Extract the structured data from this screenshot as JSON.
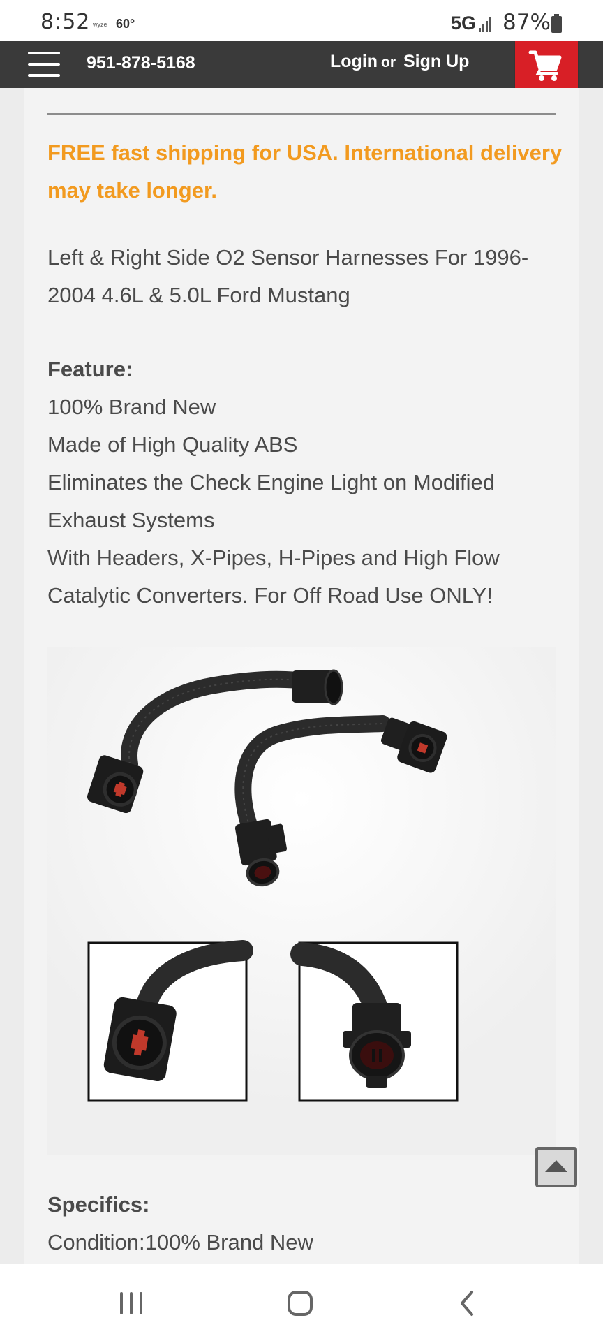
{
  "status_bar": {
    "time": "8:52",
    "wyze": "wyze",
    "temperature": "60°",
    "network": "5G",
    "battery": "87%"
  },
  "nav": {
    "phone": "951-878-5168",
    "login": "Login",
    "or": "or",
    "signup": "Sign Up",
    "menu_icon": "hamburger-menu-icon",
    "cart_icon": "shopping-cart-icon"
  },
  "content": {
    "shipping_notice": "FREE fast shipping for USA. International delivery may take longer.",
    "product_title": "Left & Right Side O2 Sensor Harnesses For 1996-2004 4.6L & 5.0L Ford Mustang",
    "feature_heading": "Feature:",
    "features": [
      "100% Brand New",
      "Made of High Quality ABS",
      "Eliminates the Check Engine Light on Modified Exhaust Systems",
      "With Headers, X-Pipes, H-Pipes and High Flow Catalytic Converters. For Off Road Use ONLY!"
    ],
    "specifics_heading": "Specifics:",
    "condition": "Condition:100% Brand New"
  },
  "colors": {
    "accent_orange": "#f29a1f",
    "cart_red": "#d81f26",
    "nav_dark": "#3a3a3a"
  }
}
